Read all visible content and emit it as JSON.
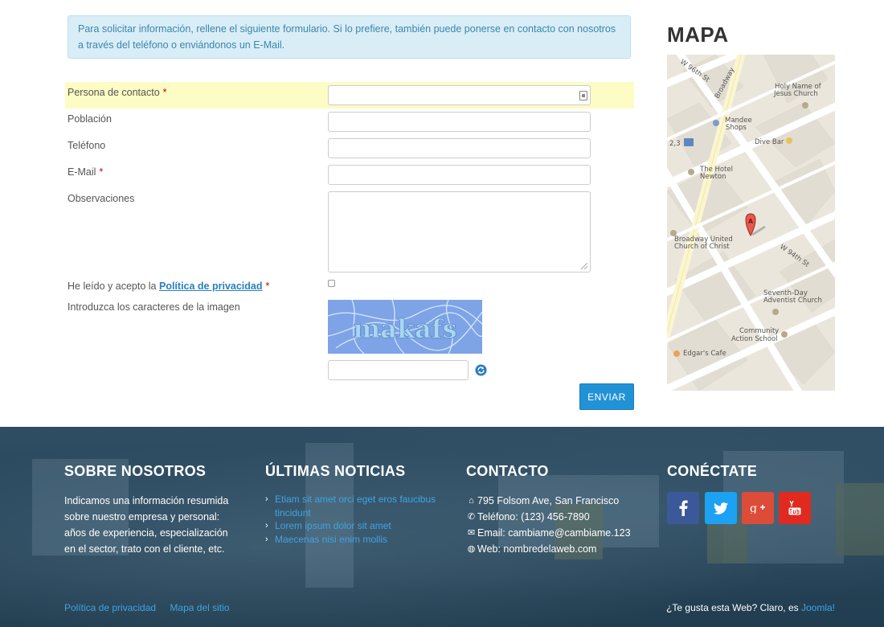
{
  "intro": {
    "text": "Para solicitar información, rellene el siguiente formulario. Si lo prefiere, también puede ponerse en contacto con nosotros  a través del teléfono o enviándonos un E-Mail."
  },
  "form": {
    "contact_label": "Persona de contacto",
    "city_label": "Población",
    "phone_label": "Teléfono",
    "email_label": "E-Mail",
    "notes_label": "Observaciones",
    "required_mark": "*",
    "privacy_prefix": "He leído y acepto la",
    "privacy_link": "Política de privacidad",
    "captcha_label": "Introduzca los caracteres de la imagen",
    "captcha_text": "makafs",
    "submit_label": "ENVIAR"
  },
  "map": {
    "title": "MAPA",
    "labels": {
      "w96": "W 96th St",
      "broadway": "Broadway",
      "holy": "Holy Name of",
      "holy2": "Jesus Church",
      "mandee": "Mandee",
      "mandee2": "Shops",
      "divebar": "Dive Bar",
      "route": "2,3",
      "hotel": "The Hotel",
      "hotel2": "Newton",
      "marker": "A",
      "buc": "Broadway United",
      "buc2": "Church of Christ",
      "w94": "W 94th St",
      "sda": "Seventh-Day",
      "sda2": "Adventist Church",
      "cas": "Community",
      "cas2": "Action School",
      "edgar": "Edgar's Cafe"
    }
  },
  "footer": {
    "about_title": "SOBRE NOSOTROS",
    "about_text": "Indicamos una información resumida sobre nuestro empresa y personal: años de experiencia, especialización en el sector, trato con el cliente, etc.",
    "news_title": "ÚLTIMAS NOTICIAS",
    "news": [
      "Etiam sit amet orci eget eros faucibus tincidunt",
      "Lorem ipsum dolor sit amet",
      "Maecenas nisi enim mollis"
    ],
    "contact_title": "CONTACTO",
    "address": "795 Folsom Ave, San Francisco",
    "phone": "Teléfono: (123) 456-7890",
    "email": "Email: cambiame@cambiame.123",
    "web": "Web: nombredelaweb.com",
    "connect_title": "CONÉCTATE",
    "social": {
      "facebook_color": "#3b5998",
      "twitter_color": "#1da1f2",
      "gplus_color": "#dd4b39",
      "youtube_color": "#e02a20"
    },
    "link_privacy": "Política de privacidad",
    "link_sitemap": "Mapa del sitio",
    "credit_prefix": "¿Te gusta esta Web? Claro, es",
    "credit_link": "Joomla!"
  }
}
